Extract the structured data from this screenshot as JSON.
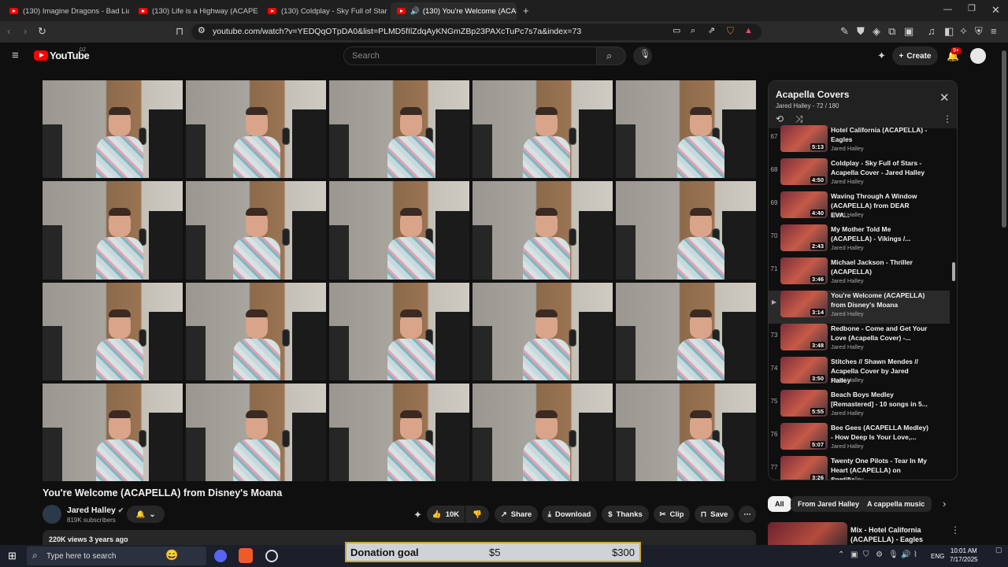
{
  "browser": {
    "tabs": [
      {
        "label": "(130) Imagine Dragons - Bad Liar (AC"
      },
      {
        "label": "(130) Life is a Highway (ACAPELLA) -"
      },
      {
        "label": "(130) Coldplay - Sky Full of Stars - Ac"
      },
      {
        "label": "(130) You're Welcome (ACAPI"
      }
    ],
    "url": "youtube.com/watch?v=YEDQqOTpDA0&list=PLMD5fIlZdqAyKNGmZBp23PAXcTuPc7s7a&index=73",
    "new_tab_icon": "plus-icon"
  },
  "youtube": {
    "logo_text": "YouTube",
    "logo_region": "DZ",
    "search_placeholder": "Search",
    "create_label": "Create",
    "notif_badge": "9+"
  },
  "video": {
    "title": "You're Welcome (ACAPELLA) from Disney's Moana",
    "channel": "Jared Halley",
    "subscribers": "819K subscribers",
    "likes": "10K",
    "share_label": "Share",
    "download_label": "Download",
    "thanks_label": "Thanks",
    "clip_label": "Clip",
    "save_label": "Save",
    "views_date": "220K views  3 years ago"
  },
  "playlist": {
    "title": "Acapella Covers",
    "owner": "Jared Halley",
    "position": "72 / 180",
    "items": [
      {
        "num": "67",
        "title": "Hotel California (ACAPELLA) - Eagles",
        "channel": "Jared Halley",
        "duration": "5:13"
      },
      {
        "num": "68",
        "title": "Coldplay - Sky Full of Stars - Acapella Cover - Jared Halley",
        "channel": "Jared Halley",
        "duration": "4:50"
      },
      {
        "num": "69",
        "title": "Waving Through A Window (ACAPELLA) from DEAR EVA...",
        "channel": "Jared Halley",
        "duration": "4:40"
      },
      {
        "num": "70",
        "title": "My Mother Told Me (ACAPELLA) - Vikings /...",
        "channel": "Jared Halley",
        "duration": "2:43"
      },
      {
        "num": "71",
        "title": "Michael Jackson - Thriller (ACAPELLA)",
        "channel": "Jared Halley",
        "duration": "3:46"
      },
      {
        "num": "▶",
        "title": "You're Welcome (ACAPELLA) from Disney's Moana",
        "channel": "Jared Halley",
        "duration": "3:14"
      },
      {
        "num": "73",
        "title": "Redbone - Come and Get Your Love (Acapella Cover) -...",
        "channel": "Jared Halley",
        "duration": "3:48"
      },
      {
        "num": "74",
        "title": "Stitches // Shawn Mendes // Acapella Cover by Jared Halley",
        "channel": "Jared Halley",
        "duration": "3:50"
      },
      {
        "num": "75",
        "title": "Beach Boys Medley [Remastered] - 10 songs in 5...",
        "channel": "Jared Halley",
        "duration": "5:55"
      },
      {
        "num": "76",
        "title": "Bee Gees (ACAPELLA Medley) - How Deep Is Your Love,...",
        "channel": "Jared Halley",
        "duration": "5:07"
      },
      {
        "num": "77",
        "title": "Twenty One Pilots - Tear In My Heart (ACAPELLA) on Spotify...",
        "channel": "Jared Halley",
        "duration": "3:26"
      }
    ]
  },
  "chips": [
    "All",
    "From Jared Halley",
    "A cappella music"
  ],
  "recommended": {
    "title": "Mix - Hotel California (ACAPELLA) - Eagles"
  },
  "taskbar": {
    "search_placeholder": "Type here to search",
    "lang": "ENG",
    "time": "10:01 AM",
    "date": "7/17/2025"
  },
  "donation": {
    "label": "Donation goal",
    "current": "$5",
    "goal": "$300"
  }
}
